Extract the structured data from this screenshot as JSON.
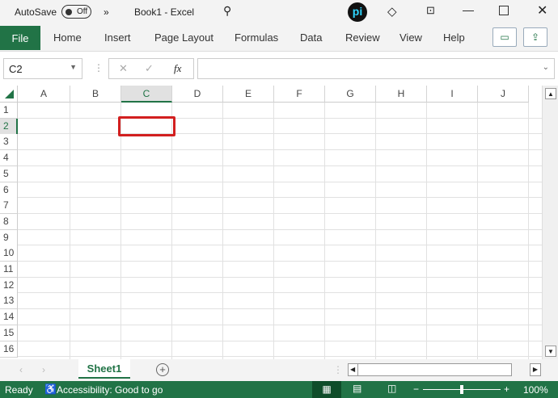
{
  "titlebar": {
    "autosave_label": "AutoSave",
    "autosave_state": "Off",
    "more": "»",
    "title": "Book1 - Excel",
    "search_icon": "search-icon",
    "account_badge": "pi"
  },
  "ribbon": {
    "tabs": [
      "File",
      "Home",
      "Insert",
      "Page Layout",
      "Formulas",
      "Data",
      "Review",
      "View",
      "Help"
    ]
  },
  "formula_bar": {
    "name_box": "C2",
    "fx": "fx",
    "cancel": "✕",
    "enter": "✓",
    "value": ""
  },
  "grid": {
    "columns": [
      "A",
      "B",
      "C",
      "D",
      "E",
      "F",
      "G",
      "H",
      "I",
      "J"
    ],
    "rows": [
      "1",
      "2",
      "3",
      "4",
      "5",
      "6",
      "7",
      "8",
      "9",
      "10",
      "11",
      "12",
      "13",
      "14",
      "15",
      "16"
    ],
    "selected_cell": "C2"
  },
  "sheets": {
    "tabs": [
      "Sheet1"
    ],
    "active": "Sheet1"
  },
  "status": {
    "ready": "Ready",
    "accessibility": "Accessibility: Good to go",
    "zoom": "100%",
    "zoom_minus": "−",
    "zoom_plus": "+",
    "zoom_level": 0.5
  },
  "colors": {
    "accent": "#217346",
    "selection": "#d21f1f"
  }
}
